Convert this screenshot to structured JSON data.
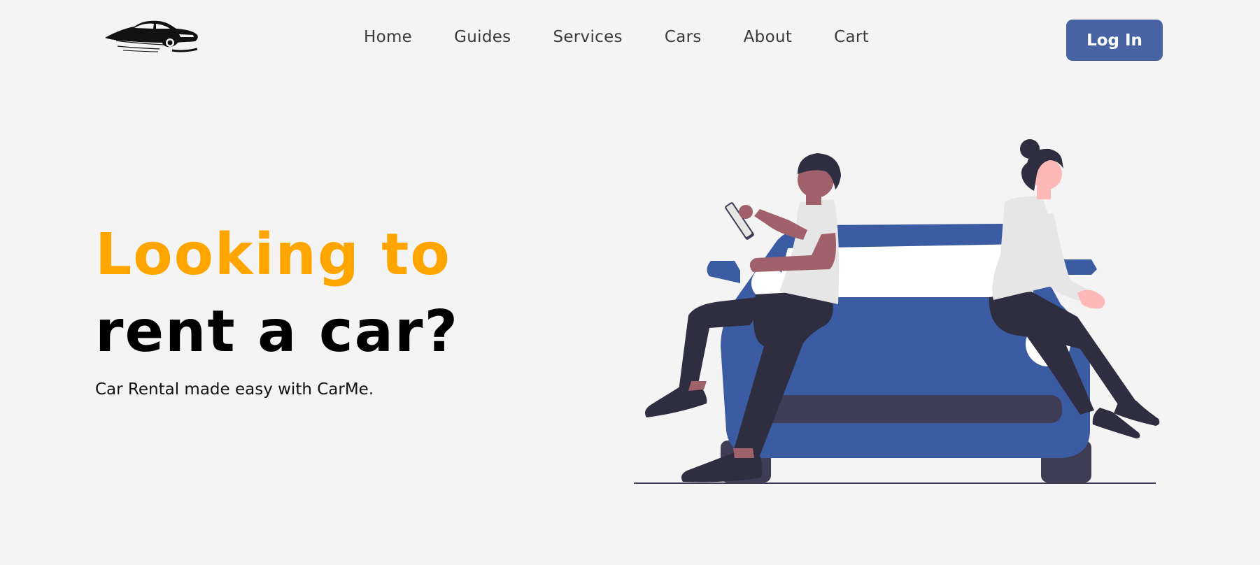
{
  "nav": {
    "logo_icon": "car-logo",
    "links": [
      "Home",
      "Guides",
      "Services",
      "Cars",
      "About",
      "Cart"
    ],
    "login_label": "Log In",
    "login_color": "#4763a4"
  },
  "hero": {
    "headline_accent": "Looking to",
    "headline_main": "rent a car?",
    "tagline": "Car Rental made easy with CarMe.",
    "accent_color": "#ffa500"
  },
  "illustration": {
    "icon": "people-sitting-on-car-illustration",
    "car_color": "#3b5ca3"
  }
}
